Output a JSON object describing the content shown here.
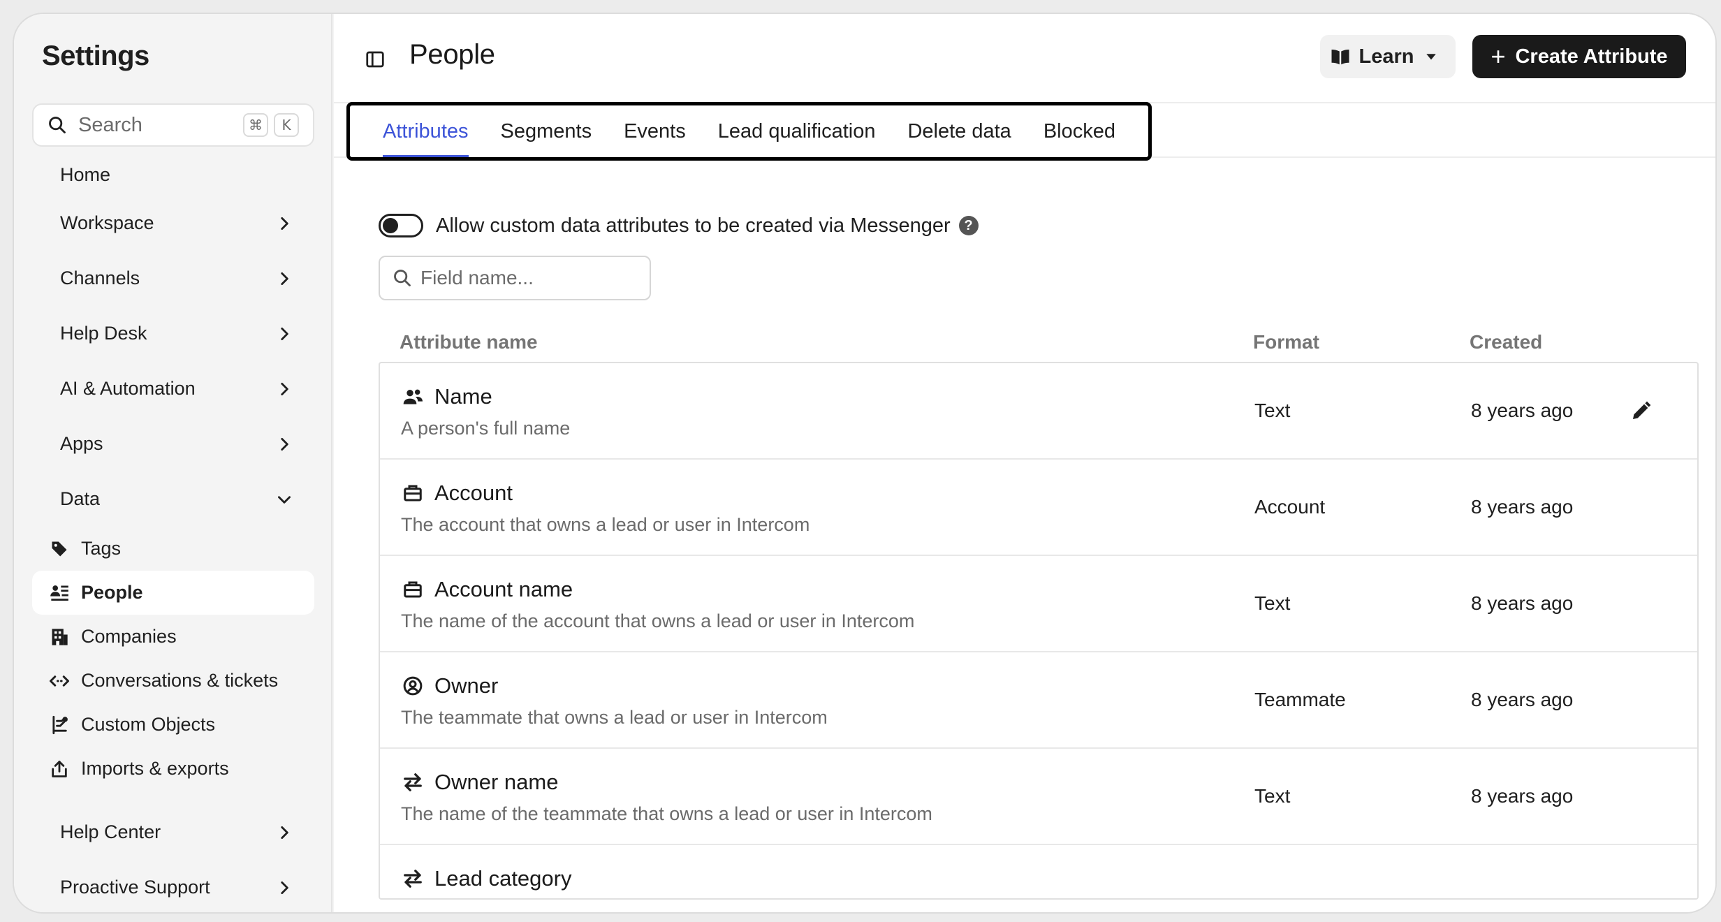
{
  "sidebar": {
    "title": "Settings",
    "search_placeholder": "Search",
    "shortcut": [
      "⌘",
      "K"
    ],
    "items": [
      {
        "label": "Home"
      },
      {
        "label": "Workspace"
      },
      {
        "label": "Channels"
      },
      {
        "label": "Help Desk"
      },
      {
        "label": "AI & Automation"
      },
      {
        "label": "Apps"
      },
      {
        "label": "Data"
      }
    ],
    "data_children": [
      {
        "label": "Tags",
        "icon": "tag-icon"
      },
      {
        "label": "People",
        "icon": "people-list-icon",
        "active": true
      },
      {
        "label": "Companies",
        "icon": "building-icon"
      },
      {
        "label": "Conversations & tickets",
        "icon": "code-arrows-icon"
      },
      {
        "label": "Custom Objects",
        "icon": "object-link-icon"
      },
      {
        "label": "Imports & exports",
        "icon": "upload-icon"
      }
    ],
    "bottom_items": [
      {
        "label": "Help Center"
      },
      {
        "label": "Proactive Support"
      }
    ]
  },
  "header": {
    "title": "People",
    "learn_label": "Learn",
    "create_label": "Create Attribute"
  },
  "tabs": [
    {
      "label": "Attributes",
      "active": true
    },
    {
      "label": "Segments"
    },
    {
      "label": "Events"
    },
    {
      "label": "Lead qualification"
    },
    {
      "label": "Delete data"
    },
    {
      "label": "Blocked"
    }
  ],
  "toggle": {
    "label": "Allow custom data attributes to be created via Messenger",
    "help": "?"
  },
  "field_search_placeholder": "Field name...",
  "table": {
    "columns": [
      "Attribute name",
      "Format",
      "Created"
    ],
    "rows": [
      {
        "name": "Name",
        "desc": "A person's full name",
        "format": "Text",
        "created": "8 years ago",
        "icon": "people-icon"
      },
      {
        "name": "Account",
        "desc": "The account that owns a lead or user in Intercom",
        "format": "Account",
        "created": "8 years ago",
        "icon": "briefcase-icon"
      },
      {
        "name": "Account name",
        "desc": "The name of the account that owns a lead or user in Intercom",
        "format": "Text",
        "created": "8 years ago",
        "icon": "briefcase-icon"
      },
      {
        "name": "Owner",
        "desc": "The teammate that owns a lead or user in Intercom",
        "format": "Teammate",
        "created": "8 years ago",
        "icon": "user-circle-icon"
      },
      {
        "name": "Owner name",
        "desc": "The name of the teammate that owns a lead or user in Intercom",
        "format": "Text",
        "created": "8 years ago",
        "icon": "swap-arrows-icon"
      },
      {
        "name": "Lead category",
        "desc": "",
        "format": "",
        "created": "",
        "icon": "swap-arrows-icon"
      }
    ]
  }
}
